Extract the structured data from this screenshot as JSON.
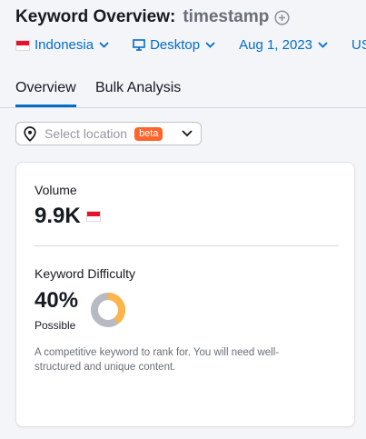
{
  "header": {
    "title_label": "Keyword Overview:",
    "keyword": "timestamp"
  },
  "filters": {
    "database": "Indonesia",
    "device": "Desktop",
    "date": "Aug 1, 2023",
    "currency": "USD"
  },
  "tabs": [
    {
      "label": "Overview",
      "active": true
    },
    {
      "label": "Bulk Analysis",
      "active": false
    }
  ],
  "location": {
    "placeholder": "Select location",
    "badge": "beta"
  },
  "volume": {
    "label": "Volume",
    "value": "9.9K"
  },
  "keyword_difficulty": {
    "label": "Keyword Difficulty",
    "value": "40%",
    "percent": 40,
    "level": "Possible",
    "description": "A competitive keyword to rank for. You will need well-structured and unique content."
  },
  "colors": {
    "accent": "#006dca",
    "beta_badge": "#ff642d",
    "kd_fill": "#fdb44a",
    "kd_track": "#b7bac2"
  }
}
